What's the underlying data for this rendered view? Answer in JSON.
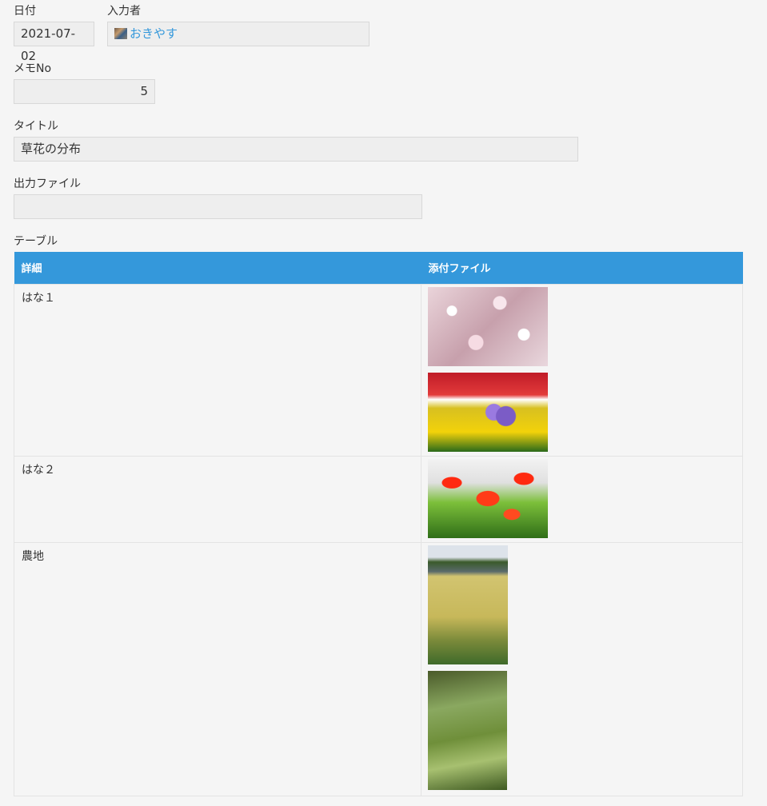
{
  "form": {
    "date": {
      "label": "日付",
      "value": "2021-07-02"
    },
    "author": {
      "label": "入力者",
      "value": "おきやす"
    },
    "memo_no": {
      "label": "メモNo",
      "value": "5"
    },
    "title": {
      "label": "タイトル",
      "value": "草花の分布"
    },
    "output_file": {
      "label": "出力ファイル",
      "value": ""
    }
  },
  "table": {
    "label": "テーブル",
    "columns": [
      "詳細",
      "添付ファイル"
    ],
    "rows": [
      {
        "detail": "はな１",
        "attachments": [
          "cherry-blossom-image",
          "pansy-flowerbed-image"
        ]
      },
      {
        "detail": "はな２",
        "attachments": [
          "red-tulip-image"
        ]
      },
      {
        "detail": "農地",
        "attachments": [
          "rice-field-image",
          "grass-image"
        ]
      }
    ]
  }
}
